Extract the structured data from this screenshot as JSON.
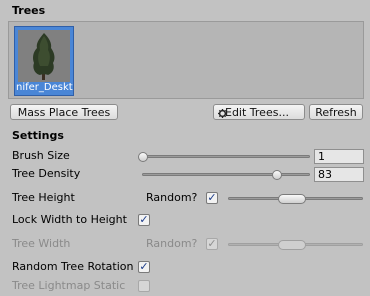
{
  "trees_header": "Trees",
  "tree_prototypes": [
    {
      "label": "nifer_Deskt",
      "selected": true
    }
  ],
  "buttons": {
    "mass_place": "Mass Place Trees",
    "edit_trees": "Edit Trees...",
    "refresh": "Refresh"
  },
  "settings_header": "Settings",
  "brush_size": {
    "label": "Brush Size",
    "value": "1",
    "slider_fraction": 0.0
  },
  "tree_density": {
    "label": "Tree Density",
    "value": "83",
    "slider_fraction": 0.83
  },
  "tree_height": {
    "label": "Tree Height",
    "random_label": "Random?",
    "random_checked": true,
    "range_min_fraction": 0.4,
    "range_max_fraction": 0.55
  },
  "lock_width": {
    "label": "Lock Width to Height",
    "checked": true
  },
  "tree_width": {
    "label": "Tree Width",
    "random_label": "Random?",
    "random_checked": true,
    "enabled": false,
    "range_min_fraction": 0.4,
    "range_max_fraction": 0.55
  },
  "random_rotation": {
    "label": "Random Tree Rotation",
    "checked": true
  },
  "lightmap_static": {
    "label": "Tree Lightmap Static",
    "checked": false,
    "enabled": false
  },
  "icons": {
    "edit": "gear-icon",
    "check": "checkmark-icon"
  },
  "colors": {
    "selection": "#4a86d6",
    "panel": "#c2c2c2"
  }
}
